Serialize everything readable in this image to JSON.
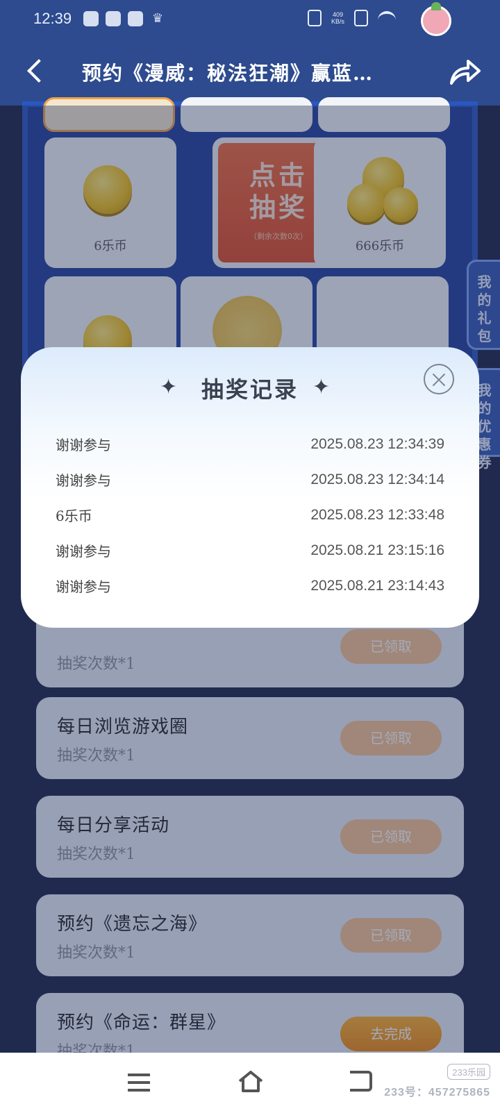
{
  "status_bar": {
    "time": "12:39",
    "network_speed": "409",
    "network_unit": "KB/s"
  },
  "header": {
    "title": "预约《漫威：秘法狂潮》赢蓝…"
  },
  "lottery": {
    "prizes": [
      {
        "label": "6乐币"
      },
      {
        "label": "666乐币"
      }
    ],
    "draw_button": {
      "main": "点击\n抽奖",
      "sub": "（剩余次数0次）"
    }
  },
  "side_tabs": {
    "gift": "我的礼包",
    "coupon": "我的优惠券"
  },
  "modal": {
    "title": "抽奖记录",
    "records": [
      {
        "name": "谢谢参与",
        "time": "2025.08.23 12:34:39"
      },
      {
        "name": "谢谢参与",
        "time": "2025.08.23 12:34:14"
      },
      {
        "name": "6乐币",
        "time": "2025.08.23 12:33:48"
      },
      {
        "name": "谢谢参与",
        "time": "2025.08.21 23:15:16"
      },
      {
        "name": "谢谢参与",
        "time": "2025.08.21 23:14:43"
      }
    ]
  },
  "tasks": [
    {
      "title": "",
      "sub": "抽奖次数*1",
      "button": "已领取"
    },
    {
      "title": "每日浏览游戏圈",
      "sub": "抽奖次数*1",
      "button": "已领取"
    },
    {
      "title": "每日分享活动",
      "sub": "抽奖次数*1",
      "button": "已领取"
    },
    {
      "title": "预约《遗忘之海》",
      "sub": "抽奖次数*1",
      "button": "已领取"
    },
    {
      "title": "预约《命运：群星》",
      "sub": "抽奖次数*1",
      "button": "去完成"
    }
  ],
  "watermark": {
    "logo": "233乐园",
    "id": "233号：457275865"
  }
}
